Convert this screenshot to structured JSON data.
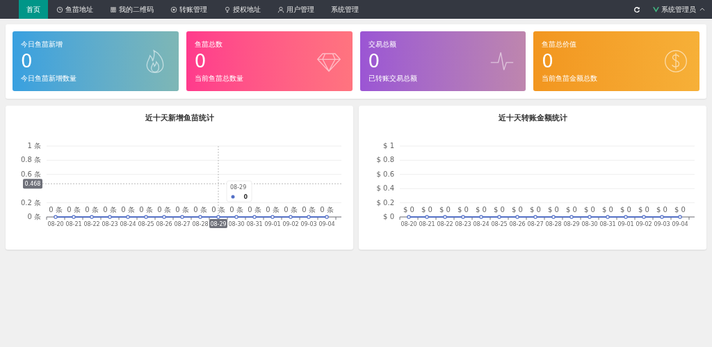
{
  "nav": {
    "items": [
      {
        "label": "首页",
        "selected": true
      },
      {
        "label": "鱼苗地址",
        "selected": false
      },
      {
        "label": "我的二维码",
        "selected": false
      },
      {
        "label": "转账管理",
        "selected": false
      },
      {
        "label": "授权地址",
        "selected": false
      },
      {
        "label": "用户管理",
        "selected": false
      },
      {
        "label": "系统管理",
        "selected": false
      }
    ],
    "user": {
      "name": "系统管理员",
      "expanded": true
    }
  },
  "stats": [
    {
      "title": "今日鱼苗新增",
      "value": "0",
      "caption": "今日鱼苗新增数量",
      "color": "#38a0e0"
    },
    {
      "title": "鱼苗总数",
      "value": "0",
      "caption": "当前鱼苗总数量",
      "color": "#ff3a8c"
    },
    {
      "title": "交易总额",
      "value": "0",
      "caption": "已转账交易总额",
      "color": "#9b55d4"
    },
    {
      "title": "鱼苗总价值",
      "value": "0",
      "caption": "当前鱼苗金额总数",
      "color": "#f2961f"
    }
  ],
  "charts": [
    {
      "chart_data": {
        "type": "line",
        "title": "近十天新增鱼苗统计",
        "categories": [
          "08-20",
          "08-21",
          "08-22",
          "08-23",
          "08-24",
          "08-25",
          "08-26",
          "08-27",
          "08-28",
          "08-29",
          "08-30",
          "08-31",
          "09-01",
          "09-02",
          "09-03",
          "09-04"
        ],
        "series": [
          {
            "color": "#5470c6",
            "values": [
              0,
              0,
              0,
              0,
              0,
              0,
              0,
              0,
              0,
              0,
              0,
              0,
              0,
              0,
              0,
              0
            ]
          }
        ],
        "grid": true,
        "marker": true,
        "ylim": [
          0,
          1
        ],
        "yticks": [
          {
            "value": 0,
            "label": "0 条"
          },
          {
            "value": 0.2,
            "label": "0.2 条"
          },
          {
            "value": 0.6,
            "label": "0.6 条"
          },
          {
            "value": 0.8,
            "label": "0.8 条"
          },
          {
            "value": 1,
            "label": "1 条"
          }
        ],
        "value_labels": [
          "0 条",
          "0 条",
          "0 条",
          "0 条",
          "0 条",
          "0 条",
          "0 条",
          "0 条",
          "0 条",
          "0 条",
          "0 条",
          "0 条",
          "0 条",
          "0 条",
          "0 条",
          "0 条"
        ],
        "ref_lines": [
          {
            "axis": "x",
            "value": "08-29"
          },
          {
            "axis": "y",
            "value": 0.468,
            "label": "0.468"
          }
        ]
      },
      "tooltip": {
        "title": "08-29",
        "value": "0"
      }
    },
    {
      "chart_data": {
        "type": "line",
        "title": "近十天转账金额统计",
        "categories": [
          "08-20",
          "08-21",
          "08-22",
          "08-23",
          "08-24",
          "08-25",
          "08-26",
          "08-27",
          "08-28",
          "08-29",
          "08-30",
          "08-31",
          "09-01",
          "09-02",
          "09-03",
          "09-04"
        ],
        "series": [
          {
            "color": "#5470c6",
            "values": [
              0,
              0,
              0,
              0,
              0,
              0,
              0,
              0,
              0,
              0,
              0,
              0,
              0,
              0,
              0,
              0
            ]
          }
        ],
        "grid": true,
        "marker": true,
        "ylim": [
          0,
          1
        ],
        "yticks": [
          {
            "value": 0,
            "label": "$ 0"
          },
          {
            "value": 0.2,
            "label": "$ 0.2"
          },
          {
            "value": 0.4,
            "label": "$ 0.4"
          },
          {
            "value": 0.6,
            "label": "$ 0.6"
          },
          {
            "value": 0.8,
            "label": "$ 0.8"
          },
          {
            "value": 1,
            "label": "$ 1"
          }
        ],
        "value_labels": [
          "$ 0",
          "$ 0",
          "$ 0",
          "$ 0",
          "$ 0",
          "$ 0",
          "$ 0",
          "$ 0",
          "$ 0",
          "$ 0",
          "$ 0",
          "$ 0",
          "$ 0",
          "$ 0",
          "$ 0",
          "$ 0"
        ]
      }
    }
  ]
}
